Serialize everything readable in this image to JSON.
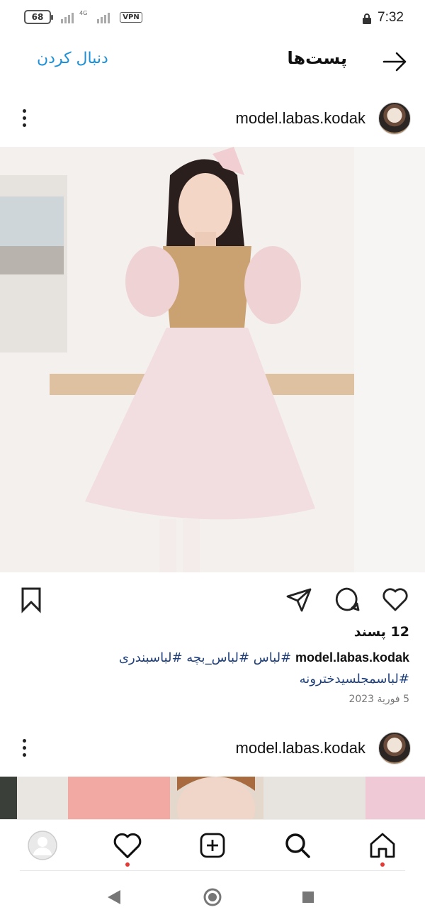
{
  "status_bar": {
    "battery": "68",
    "network_type": "4G",
    "vpn": "VPN",
    "time": "7:32"
  },
  "header": {
    "title": "پست‌ها",
    "follow_label": "دنبال کردن",
    "back_icon": "arrow-right-icon"
  },
  "posts": [
    {
      "username": "model.labas.kodak",
      "likes": "12 پسند",
      "caption_user": "model.labas.kodak",
      "caption_tags": "#لباس #لباس_بچه #لباسبندری #لباسمجلسیدخترونه",
      "date": "5 فورية 2023"
    },
    {
      "username": "model.labas.kodak"
    }
  ],
  "actions": {
    "like_icon": "heart-icon",
    "comment_icon": "comment-icon",
    "share_icon": "send-icon",
    "save_icon": "bookmark-icon"
  },
  "bottom_nav": [
    "home-icon",
    "search-icon",
    "add-post-icon",
    "activity-heart-icon",
    "profile-avatar"
  ],
  "colors": {
    "link": "#1e90d8",
    "hashtag": "#1e3f7a",
    "notification_dot": "#e53935"
  }
}
